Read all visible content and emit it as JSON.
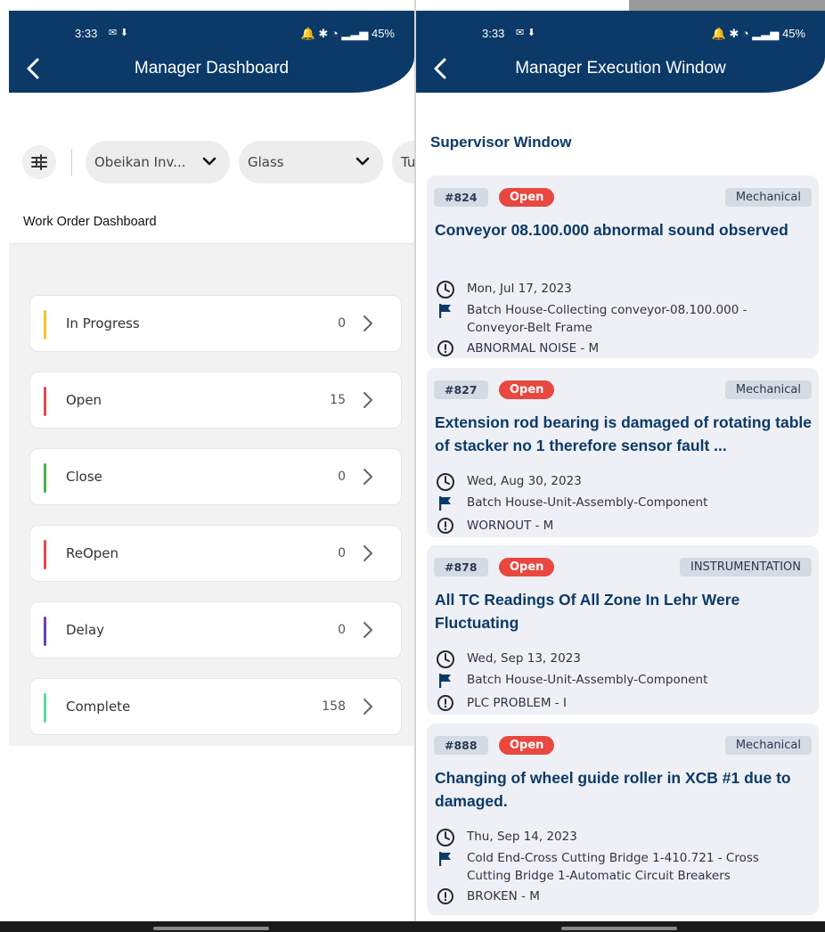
{
  "status_bar": {
    "time": "3:33",
    "right": "45%"
  },
  "left": {
    "header_title": "Manager Dashboard",
    "filters": {
      "company": "Obeikan Inv...",
      "type": "Glass",
      "third": "Tu"
    },
    "section_title": "Work Order Dashboard",
    "statuses": [
      {
        "label": "In Progress",
        "count": "0",
        "color": "#f5c32c"
      },
      {
        "label": "Open",
        "count": "15",
        "color": "#e5484d"
      },
      {
        "label": "Close",
        "count": "0",
        "color": "#4caf50"
      },
      {
        "label": "ReOpen",
        "count": "0",
        "color": "#e5484d"
      },
      {
        "label": "Delay",
        "count": "0",
        "color": "#6a3fb5"
      },
      {
        "label": "Complete",
        "count": "158",
        "color": "#5ed9a0"
      }
    ]
  },
  "right": {
    "header_title": "Manager Execution Window",
    "section_title": "Supervisor Window",
    "work_orders": [
      {
        "id": "#824",
        "status": "Open",
        "category": "Mechanical",
        "title": "Conveyor 08.100.000 abnormal sound observed",
        "date": "Mon, Jul 17, 2023",
        "location_line1": "Batch House-Collecting conveyor-08.100.000 -",
        "location_line2": "Conveyor-Belt Frame",
        "problem": "ABNORMAL NOISE - M"
      },
      {
        "id": "#827",
        "status": "Open",
        "category": "Mechanical",
        "title": "Extension rod bearing is damaged of rotating table of stacker no 1 therefore sensor fault ...",
        "date": "Wed, Aug 30, 2023",
        "location_line1": "Batch House-Unit-Assembly-Component",
        "location_line2": "",
        "problem": "WORNOUT - M"
      },
      {
        "id": "#878",
        "status": "Open",
        "category": "INSTRUMENTATION",
        "title": " All TC Readings Of All Zone In Lehr Were Fluctuating",
        "date": "Wed, Sep 13, 2023",
        "location_line1": "Batch House-Unit-Assembly-Component",
        "location_line2": "",
        "problem": "PLC PROBLEM - I"
      },
      {
        "id": "#888",
        "status": "Open",
        "category": "Mechanical",
        "title": "Changing of wheel guide roller in XCB #1 due to damaged.",
        "date": "Thu, Sep 14, 2023",
        "location_line1": "Cold End-Cross Cutting Bridge 1-410.721 - Cross",
        "location_line2": "Cutting Bridge 1-Automatic Circuit Breakers",
        "problem": "BROKEN - M"
      }
    ]
  }
}
